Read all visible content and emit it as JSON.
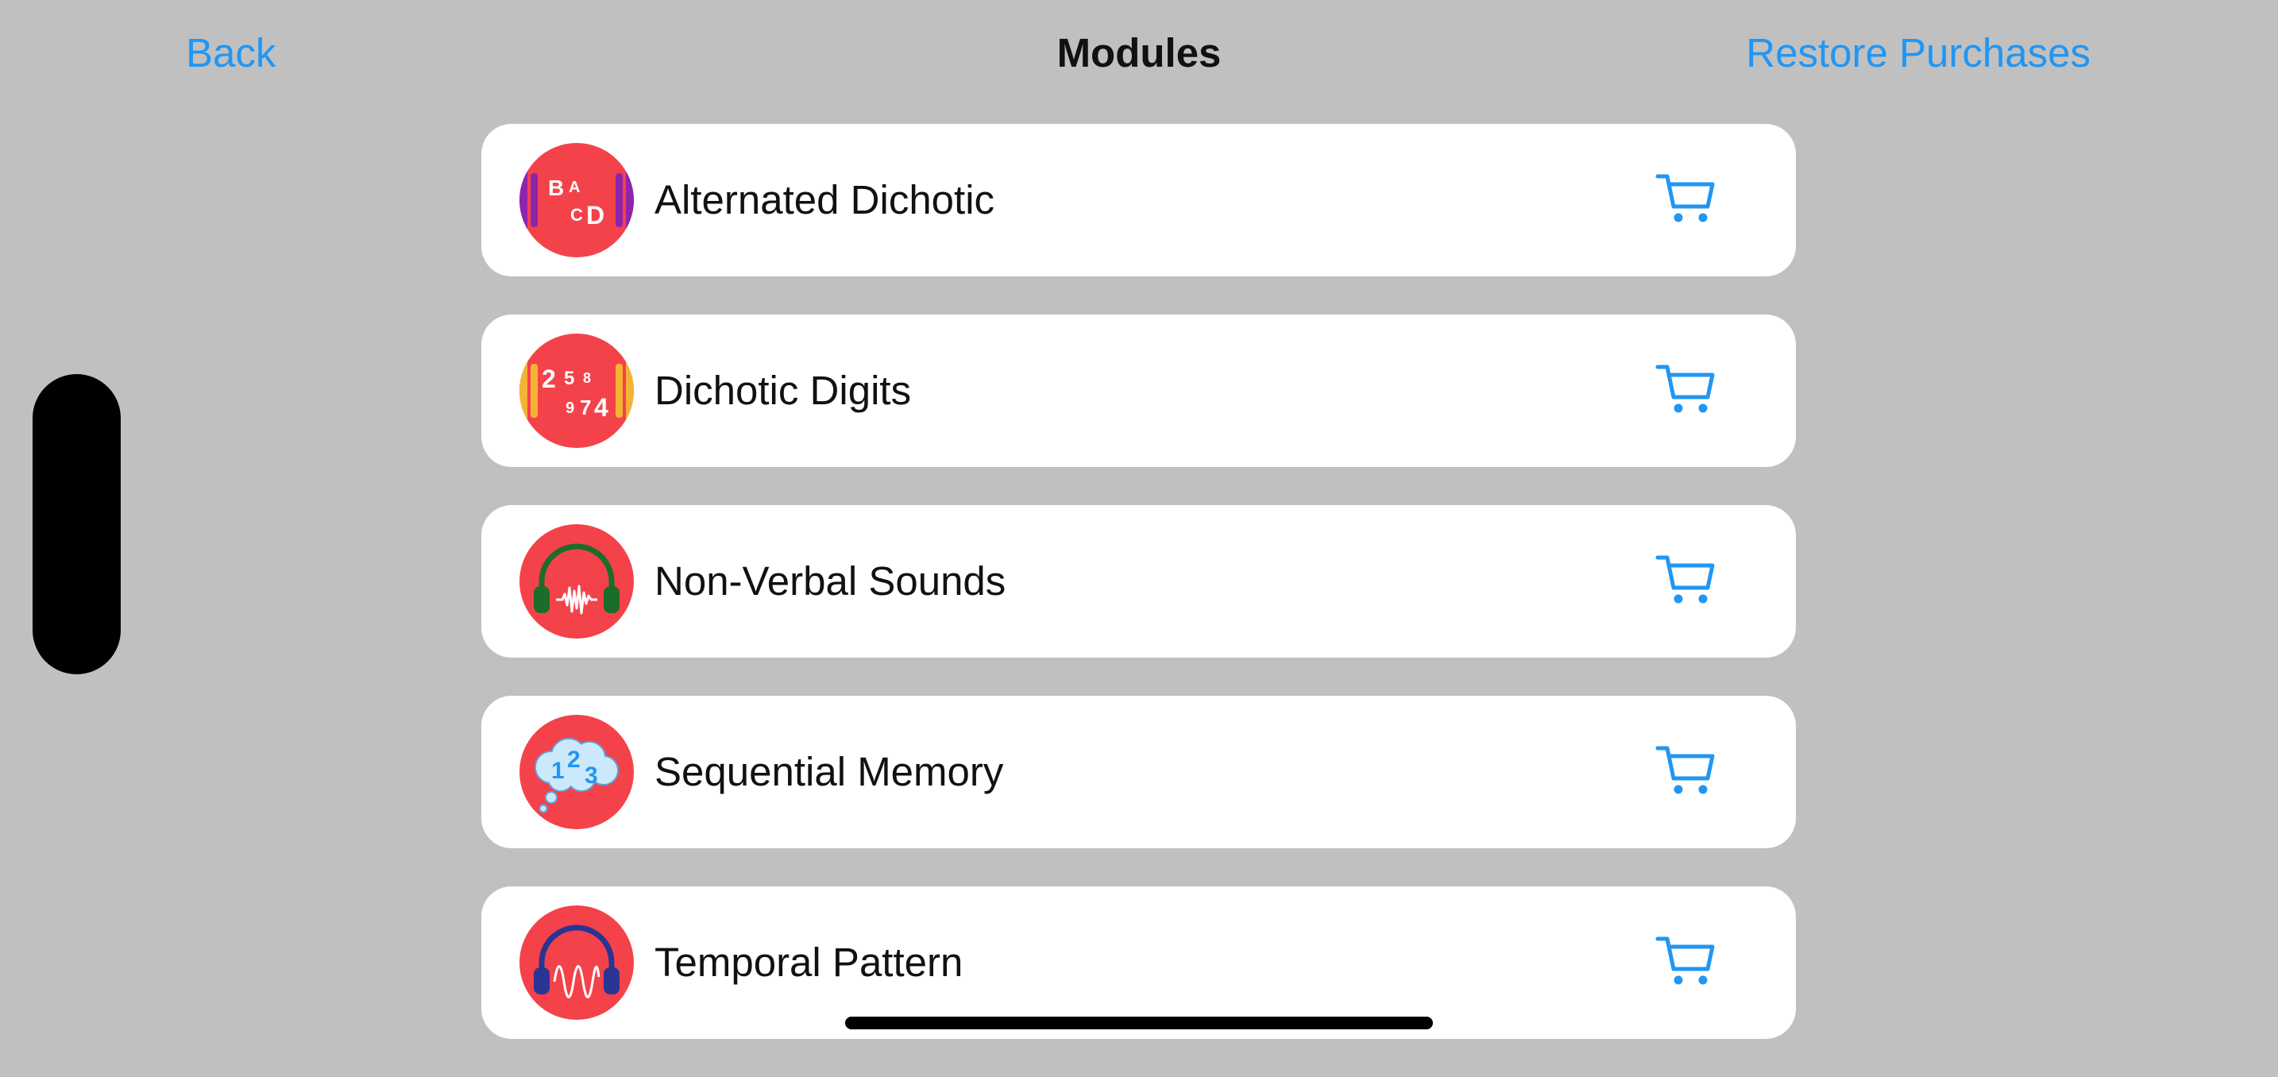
{
  "nav": {
    "back_label": "Back",
    "title": "Modules",
    "restore_label": "Restore Purchases"
  },
  "modules": [
    {
      "label": "Alternated Dichotic",
      "icon": "alternated-dichotic-icon",
      "icon_text": [
        "B",
        "A",
        "C",
        "D"
      ]
    },
    {
      "label": "Dichotic Digits",
      "icon": "dichotic-digits-icon",
      "icon_text": [
        "2",
        "5",
        "8",
        "9",
        "7",
        "4"
      ]
    },
    {
      "label": "Non-Verbal Sounds",
      "icon": "headphones-waveform-icon"
    },
    {
      "label": "Sequential Memory",
      "icon": "thought-cloud-icon",
      "icon_text": [
        "1",
        "2",
        "3"
      ]
    },
    {
      "label": "Temporal Pattern",
      "icon": "headphones-sine-wave-icon"
    }
  ],
  "colors": {
    "background": "#c0c0c0",
    "accent": "#2196f3",
    "icon_circle": "#f4424a",
    "card": "#ffffff"
  },
  "action_icon": "cart-icon"
}
